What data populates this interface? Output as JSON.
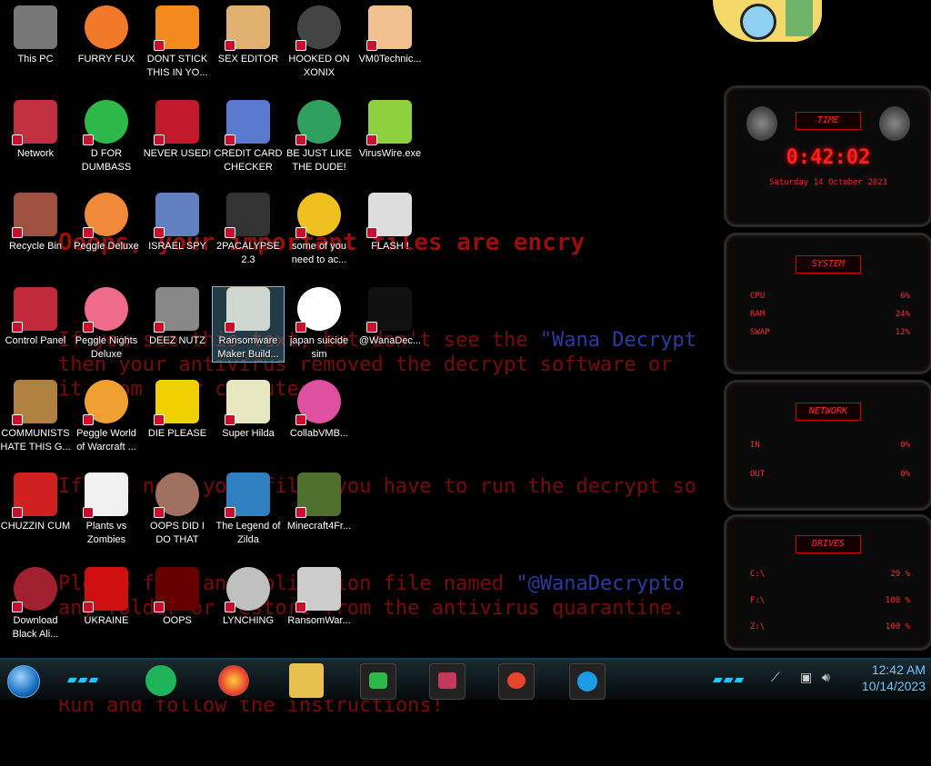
{
  "wallpaper": {
    "line1": "Ooops, your important files are encry",
    "line2a": "If you see this text, but don't see the ",
    "line2b": "\"Wana Decrypt",
    "line3": "then your antivirus removed the decrypt software or",
    "line4": "it from your computer.",
    "line5": "If you need your files you have to run the decrypt so",
    "line6a": "Please find an application file named ",
    "line6b": "\"@WanaDecrypto",
    "line7": "any folder or restore from the antivirus quarantine.",
    "line8": "Run and follow the instructions!"
  },
  "icons": [
    {
      "label": "This PC"
    },
    {
      "label": "FURRY FUX"
    },
    {
      "label": "DONT STICK THIS IN YO..."
    },
    {
      "label": "SEX EDITOR"
    },
    {
      "label": "HOOKED ON XONIX"
    },
    {
      "label": "VM0Technic..."
    },
    {
      "label": "Network"
    },
    {
      "label": "D FOR DUMBASS"
    },
    {
      "label": "NEVER USED!"
    },
    {
      "label": "CREDIT CARD CHECKER"
    },
    {
      "label": "BE JUST LIKE THE DUDE!"
    },
    {
      "label": "VirusWire.exe"
    },
    {
      "label": "Recycle Bin"
    },
    {
      "label": "Peggle Deluxe"
    },
    {
      "label": "ISRAEL SPY"
    },
    {
      "label": "2PACALYPSE 2.3"
    },
    {
      "label": "some of you need to ac..."
    },
    {
      "label": "FLASH !"
    },
    {
      "label": "Control Panel"
    },
    {
      "label": "Peggle Nights Deluxe"
    },
    {
      "label": "DEEZ NUTZ"
    },
    {
      "label": "Ransomware Maker Build..."
    },
    {
      "label": "japan suicide sim"
    },
    {
      "label": "@WanaDec..."
    },
    {
      "label": "COMMUNISTS HATE THIS G..."
    },
    {
      "label": "Peggle World of Warcraft ..."
    },
    {
      "label": "DIE PLEASE"
    },
    {
      "label": "Super Hilda"
    },
    {
      "label": "CollabVMB..."
    },
    {
      "label": "CHUZZIN CUM"
    },
    {
      "label": "Plants vs Zombies"
    },
    {
      "label": "OOPS DID I DO THAT"
    },
    {
      "label": "The Legend of Zilda"
    },
    {
      "label": "Minecraft4Fr..."
    },
    {
      "label": "Download Black Ali..."
    },
    {
      "label": "UKRAINE"
    },
    {
      "label": "OOPS"
    },
    {
      "label": "LYNCHING"
    },
    {
      "label": "RansomWar..."
    }
  ],
  "widgets": {
    "time": {
      "title": "TIME",
      "clock": "0:42:02",
      "date": "Saturday 14 October 2023"
    },
    "system": {
      "title": "SYSTEM",
      "rows": [
        {
          "k": "CPU",
          "v": "6%"
        },
        {
          "k": "RAM",
          "v": "24%"
        },
        {
          "k": "SWAP",
          "v": "12%"
        }
      ]
    },
    "network": {
      "title": "NETWORK",
      "rows": [
        {
          "k": "IN",
          "v": "0%"
        },
        {
          "k": "OUT",
          "v": "0%"
        }
      ]
    },
    "drives": {
      "title": "DRIVES",
      "rows": [
        {
          "k": "C:\\",
          "v": "29 %"
        },
        {
          "k": "F:\\",
          "v": "100 %"
        },
        {
          "k": "Z:\\",
          "v": "100 %"
        }
      ]
    }
  },
  "taskbar": {
    "time": "12:42 AM",
    "date": "10/14/2023"
  },
  "colors": {
    "accent": "#ff2a2a",
    "tray": "#6ec6ff"
  }
}
